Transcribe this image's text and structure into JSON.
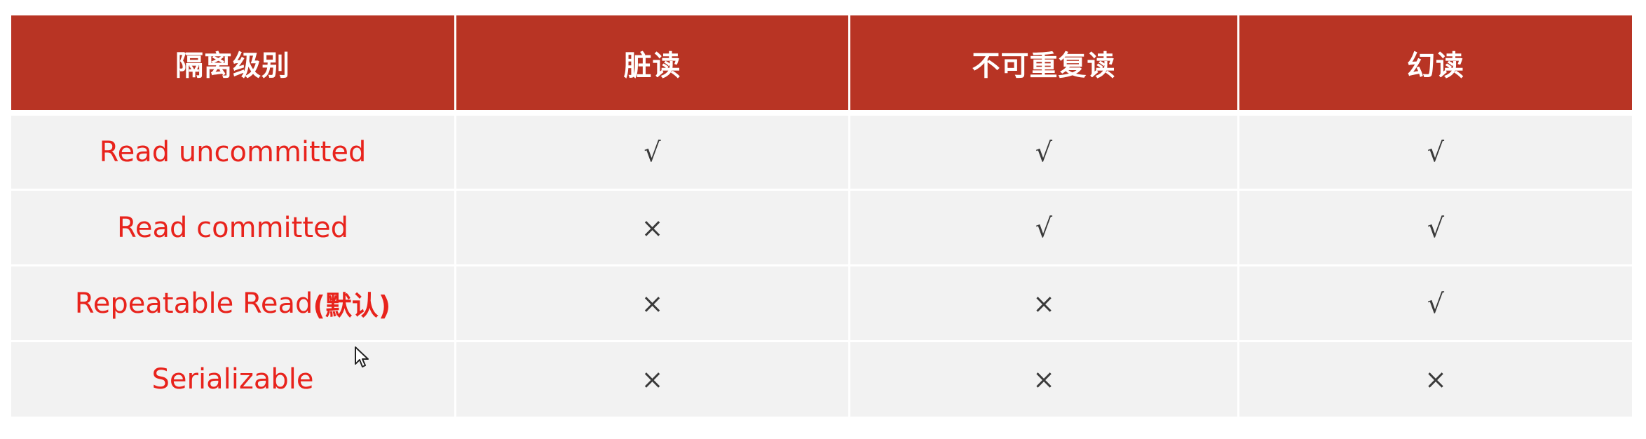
{
  "table": {
    "headers": [
      "隔离级别",
      "脏读",
      "不可重复读",
      "幻读"
    ],
    "rows": [
      {
        "level": "Read uncommitted",
        "suffix": "",
        "dirty_read": "√",
        "non_repeatable_read": "√",
        "phantom_read": "√"
      },
      {
        "level": "Read committed",
        "suffix": "",
        "dirty_read": "×",
        "non_repeatable_read": "√",
        "phantom_read": "√"
      },
      {
        "level": "Repeatable Read",
        "suffix": "(默认)",
        "dirty_read": "×",
        "non_repeatable_read": "×",
        "phantom_read": "√"
      },
      {
        "level": "Serializable",
        "suffix": "",
        "dirty_read": "×",
        "non_repeatable_read": "×",
        "phantom_read": "×"
      }
    ]
  },
  "colors": {
    "header_bg": "#b83424",
    "header_text": "#ffffff",
    "row_bg": "#f2f2f2",
    "level_text": "#e8231c",
    "mark_text": "#3a3a3a"
  },
  "icons": {
    "cursor": "mouse-pointer-icon"
  }
}
